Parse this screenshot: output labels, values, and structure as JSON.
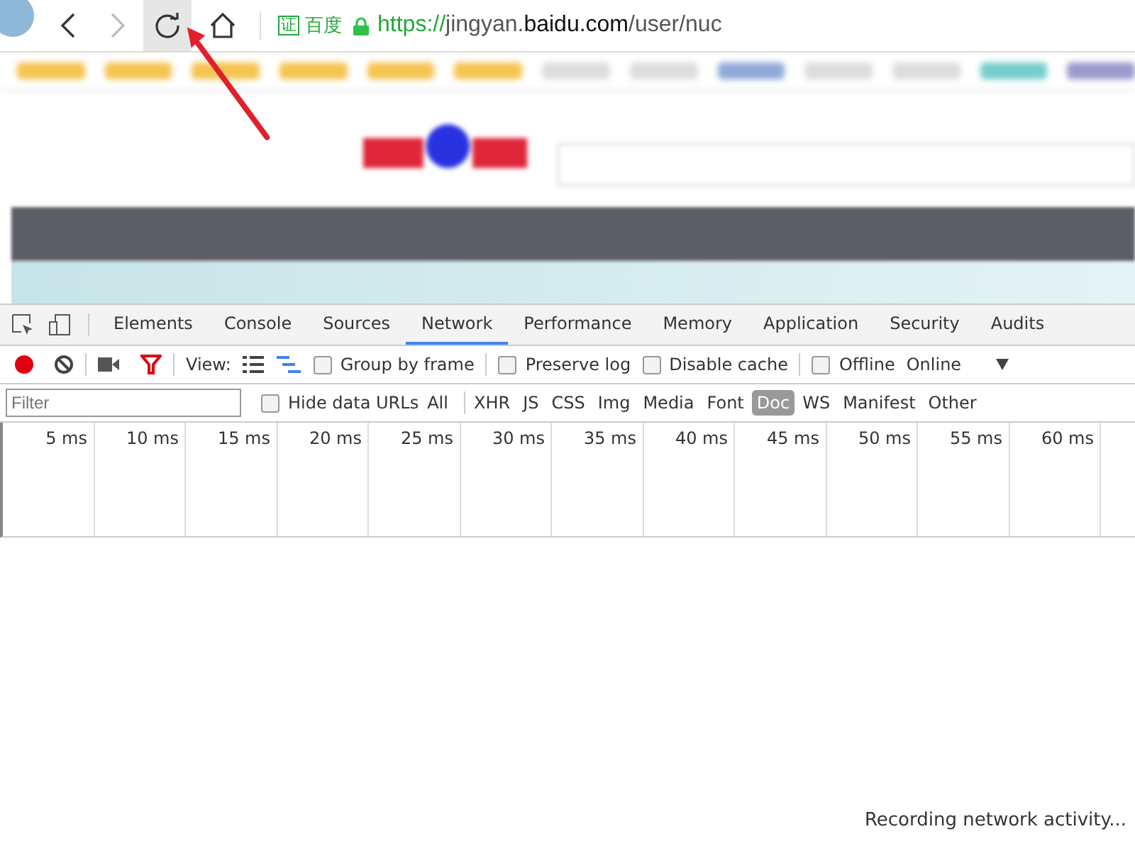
{
  "browser": {
    "nav_buttons": [
      {
        "kind": "back",
        "hovered": false
      },
      {
        "kind": "forward",
        "hovered": false
      },
      {
        "kind": "reload",
        "hovered": true
      },
      {
        "kind": "home",
        "hovered": false
      }
    ],
    "site_badge": "证",
    "site_name": "百度",
    "url_parts": [
      {
        "kind": "scheme",
        "text": "https://"
      },
      {
        "kind": "plain",
        "text": "jingyan."
      },
      {
        "kind": "domain",
        "text": "baidu.com"
      },
      {
        "kind": "plain",
        "text": "/user/nuc"
      }
    ]
  },
  "devtools": {
    "tabs": [
      {
        "label": "Elements",
        "selected": false
      },
      {
        "label": "Console",
        "selected": false
      },
      {
        "label": "Sources",
        "selected": false
      },
      {
        "label": "Network",
        "selected": true
      },
      {
        "label": "Performance",
        "selected": false
      },
      {
        "label": "Memory",
        "selected": false
      },
      {
        "label": "Application",
        "selected": false
      },
      {
        "label": "Security",
        "selected": false
      },
      {
        "label": "Audits",
        "selected": false
      }
    ],
    "toolbar": {
      "recording": true,
      "filter_on": true,
      "view_label": "View:",
      "view_modes": [
        {
          "kind": "list",
          "selected": false
        },
        {
          "kind": "waterfall",
          "selected": true
        }
      ],
      "options": [
        {
          "label": "Group by frame",
          "checked": false
        },
        {
          "label": "Preserve log",
          "checked": false
        },
        {
          "label": "Disable cache",
          "checked": false
        },
        {
          "label": "Offline",
          "checked": false
        }
      ],
      "throttle": "Online"
    },
    "filter": {
      "placeholder": "Filter",
      "hide_data_urls": {
        "label": "Hide data URLs",
        "checked": false
      },
      "types": [
        {
          "label": "All",
          "selected": false
        },
        {
          "label": "XHR",
          "selected": false
        },
        {
          "label": "JS",
          "selected": false
        },
        {
          "label": "CSS",
          "selected": false
        },
        {
          "label": "Img",
          "selected": false
        },
        {
          "label": "Media",
          "selected": false
        },
        {
          "label": "Font",
          "selected": false
        },
        {
          "label": "Doc",
          "selected": true
        },
        {
          "label": "WS",
          "selected": false
        },
        {
          "label": "Manifest",
          "selected": false
        },
        {
          "label": "Other",
          "selected": false
        }
      ]
    },
    "timeline_ticks": [
      "5 ms",
      "10 ms",
      "15 ms",
      "20 ms",
      "25 ms",
      "30 ms",
      "35 ms",
      "40 ms",
      "45 ms",
      "50 ms",
      "55 ms",
      "60 ms"
    ],
    "status": "Recording network activity..."
  }
}
